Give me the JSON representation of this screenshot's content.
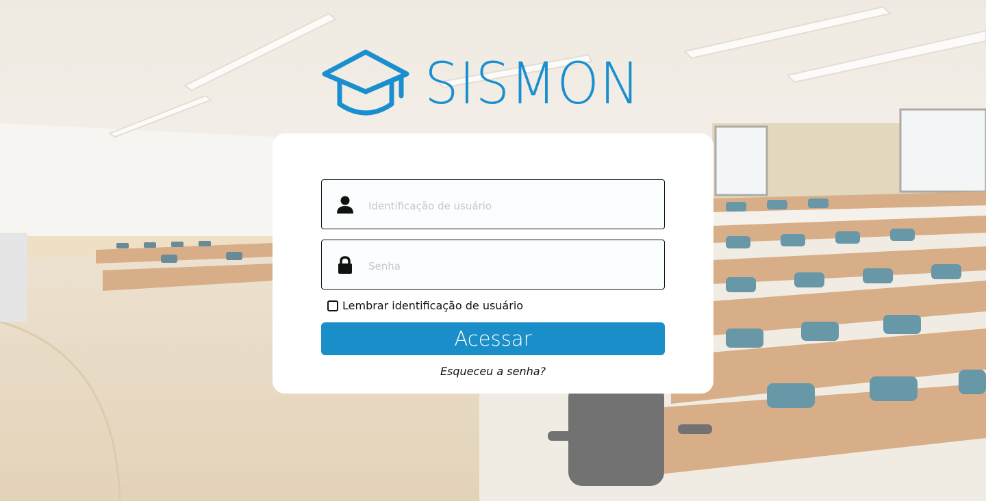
{
  "brand": {
    "name": "SISMON",
    "color": "#1a8fd0",
    "logo_icon": "graduation-cap-icon"
  },
  "login": {
    "username_placeholder": "Identificação de usuário",
    "username_icon": "user-icon",
    "password_placeholder": "Senha",
    "password_icon": "lock-icon",
    "remember_label": "Lembrar identificação de usuário",
    "remember_checked": false,
    "submit_label": "Acessar",
    "forgot_label": "Esqueceu a senha?"
  },
  "background": {
    "scene": "lecture-hall-photo"
  },
  "colors": {
    "accent": "#1a8ec8",
    "card": "#ffffff"
  }
}
